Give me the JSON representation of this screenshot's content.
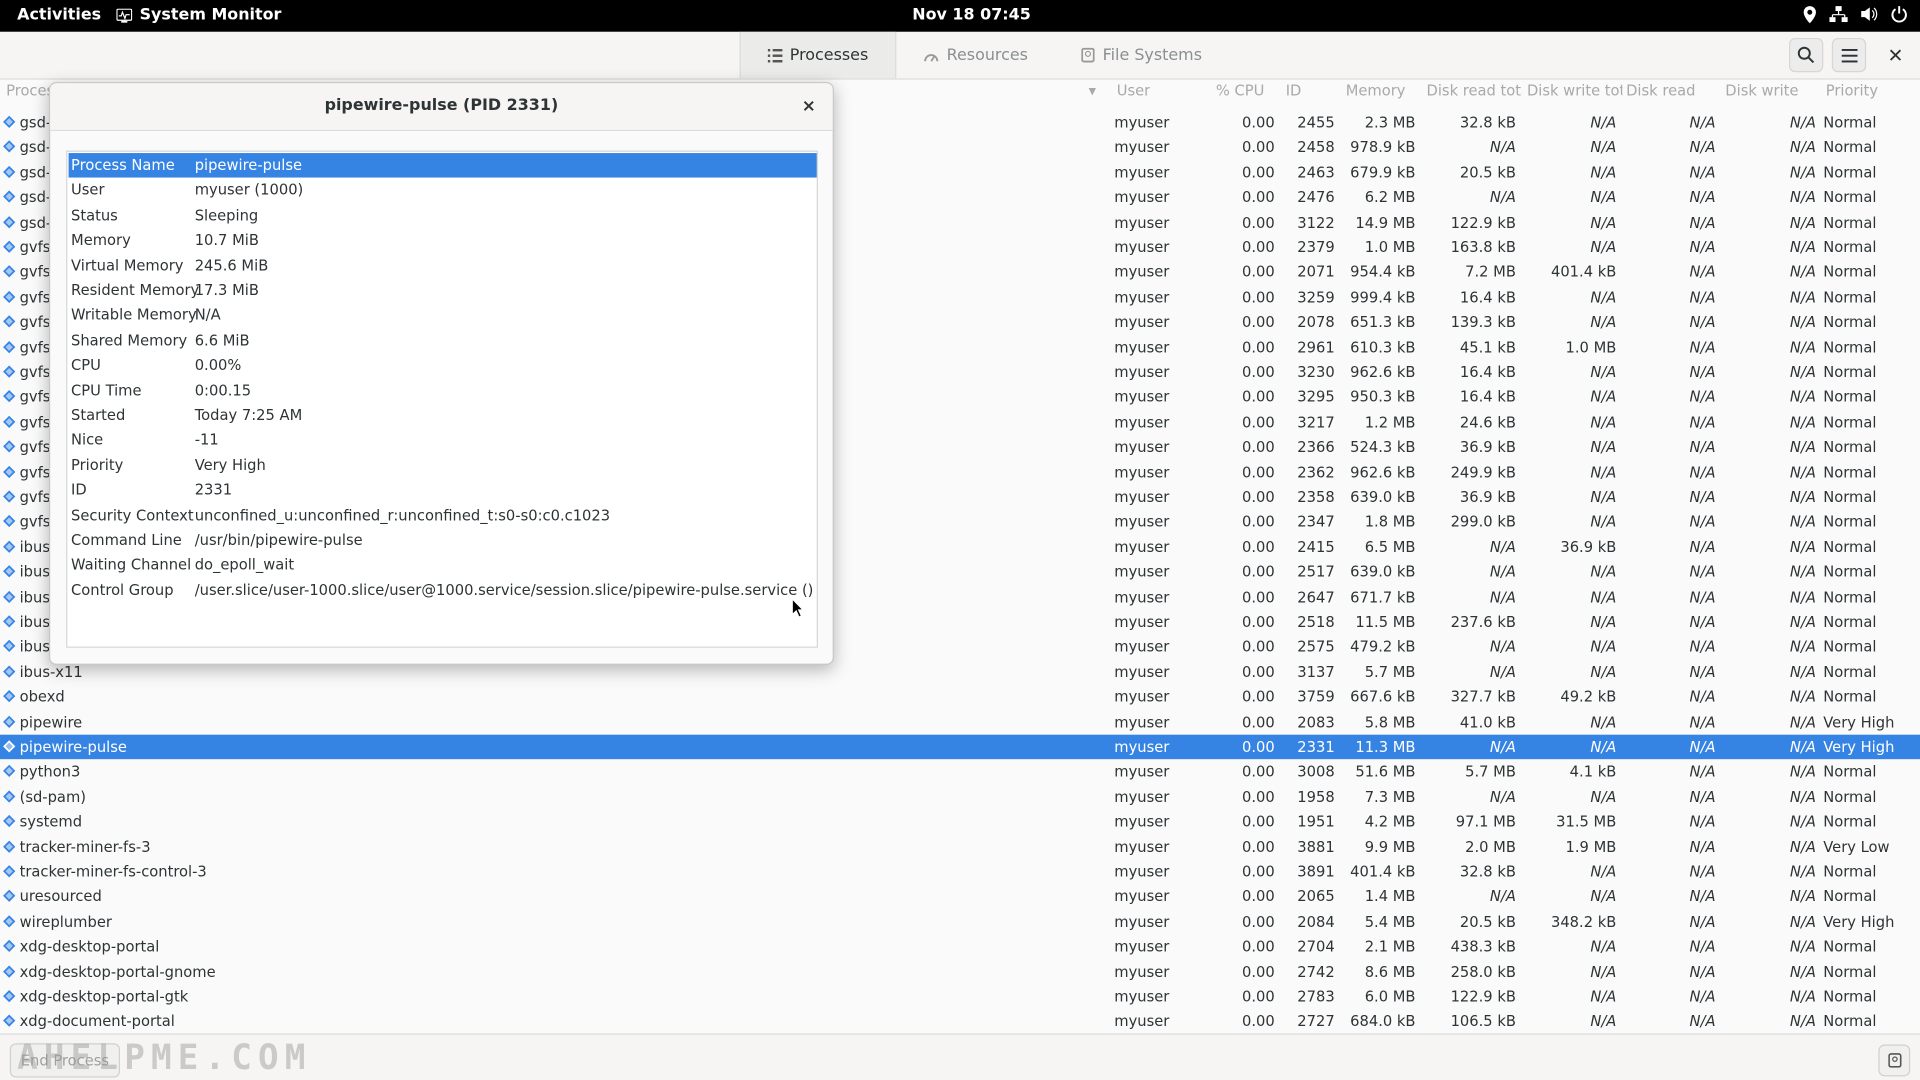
{
  "topbar": {
    "activities": "Activities",
    "app_name": "System Monitor",
    "clock": "Nov 18  07:45"
  },
  "header": {
    "tabs": [
      {
        "label": "Processes",
        "icon": "list-icon"
      },
      {
        "label": "Resources",
        "icon": "gauge-icon"
      },
      {
        "label": "File Systems",
        "icon": "disk-icon"
      }
    ]
  },
  "columns": {
    "process": "Proces",
    "user": "User",
    "cpu": "% CPU",
    "id": "ID",
    "memory": "Memory",
    "disk_read_total": "Disk read tota",
    "disk_write_total": "Disk write tot",
    "disk_read": "Disk read",
    "disk_write": "Disk write",
    "priority": "Priority"
  },
  "rows": [
    {
      "name": "gsd-",
      "user": "myuser",
      "cpu": "0.00",
      "id": "2455",
      "mem": "2.3 MB",
      "rtot": "32.8 kB",
      "wtot": "N/A",
      "rd": "N/A",
      "wr": "N/A",
      "prio": "Normal"
    },
    {
      "name": "gsd-",
      "user": "myuser",
      "cpu": "0.00",
      "id": "2458",
      "mem": "978.9 kB",
      "rtot": "N/A",
      "wtot": "N/A",
      "rd": "N/A",
      "wr": "N/A",
      "prio": "Normal"
    },
    {
      "name": "gsd-",
      "user": "myuser",
      "cpu": "0.00",
      "id": "2463",
      "mem": "679.9 kB",
      "rtot": "20.5 kB",
      "wtot": "N/A",
      "rd": "N/A",
      "wr": "N/A",
      "prio": "Normal"
    },
    {
      "name": "gsd-",
      "user": "myuser",
      "cpu": "0.00",
      "id": "2476",
      "mem": "6.2 MB",
      "rtot": "N/A",
      "wtot": "N/A",
      "rd": "N/A",
      "wr": "N/A",
      "prio": "Normal"
    },
    {
      "name": "gsd-",
      "user": "myuser",
      "cpu": "0.00",
      "id": "3122",
      "mem": "14.9 MB",
      "rtot": "122.9 kB",
      "wtot": "N/A",
      "rd": "N/A",
      "wr": "N/A",
      "prio": "Normal"
    },
    {
      "name": "gvfs-",
      "user": "myuser",
      "cpu": "0.00",
      "id": "2379",
      "mem": "1.0 MB",
      "rtot": "163.8 kB",
      "wtot": "N/A",
      "rd": "N/A",
      "wr": "N/A",
      "prio": "Normal"
    },
    {
      "name": "gvfsd",
      "user": "myuser",
      "cpu": "0.00",
      "id": "2071",
      "mem": "954.4 kB",
      "rtot": "7.2 MB",
      "wtot": "401.4 kB",
      "rd": "N/A",
      "wr": "N/A",
      "prio": "Normal"
    },
    {
      "name": "gvfsd",
      "user": "myuser",
      "cpu": "0.00",
      "id": "3259",
      "mem": "999.4 kB",
      "rtot": "16.4 kB",
      "wtot": "N/A",
      "rd": "N/A",
      "wr": "N/A",
      "prio": "Normal"
    },
    {
      "name": "gvfsd",
      "user": "myuser",
      "cpu": "0.00",
      "id": "2078",
      "mem": "651.3 kB",
      "rtot": "139.3 kB",
      "wtot": "N/A",
      "rd": "N/A",
      "wr": "N/A",
      "prio": "Normal"
    },
    {
      "name": "gvfsd",
      "user": "myuser",
      "cpu": "0.00",
      "id": "2961",
      "mem": "610.3 kB",
      "rtot": "45.1 kB",
      "wtot": "1.0 MB",
      "rd": "N/A",
      "wr": "N/A",
      "prio": "Normal"
    },
    {
      "name": "gvfsd",
      "user": "myuser",
      "cpu": "0.00",
      "id": "3230",
      "mem": "962.6 kB",
      "rtot": "16.4 kB",
      "wtot": "N/A",
      "rd": "N/A",
      "wr": "N/A",
      "prio": "Normal"
    },
    {
      "name": "gvfsd",
      "user": "myuser",
      "cpu": "0.00",
      "id": "3295",
      "mem": "950.3 kB",
      "rtot": "16.4 kB",
      "wtot": "N/A",
      "rd": "N/A",
      "wr": "N/A",
      "prio": "Normal"
    },
    {
      "name": "gvfsd",
      "user": "myuser",
      "cpu": "0.00",
      "id": "3217",
      "mem": "1.2 MB",
      "rtot": "24.6 kB",
      "wtot": "N/A",
      "rd": "N/A",
      "wr": "N/A",
      "prio": "Normal"
    },
    {
      "name": "gvfs-",
      "user": "myuser",
      "cpu": "0.00",
      "id": "2366",
      "mem": "524.3 kB",
      "rtot": "36.9 kB",
      "wtot": "N/A",
      "rd": "N/A",
      "wr": "N/A",
      "prio": "Normal"
    },
    {
      "name": "gvfs-",
      "user": "myuser",
      "cpu": "0.00",
      "id": "2362",
      "mem": "962.6 kB",
      "rtot": "249.9 kB",
      "wtot": "N/A",
      "rd": "N/A",
      "wr": "N/A",
      "prio": "Normal"
    },
    {
      "name": "gvfs-",
      "user": "myuser",
      "cpu": "0.00",
      "id": "2358",
      "mem": "639.0 kB",
      "rtot": "36.9 kB",
      "wtot": "N/A",
      "rd": "N/A",
      "wr": "N/A",
      "prio": "Normal"
    },
    {
      "name": "gvfs-",
      "user": "myuser",
      "cpu": "0.00",
      "id": "2347",
      "mem": "1.8 MB",
      "rtot": "299.0 kB",
      "wtot": "N/A",
      "rd": "N/A",
      "wr": "N/A",
      "prio": "Normal"
    },
    {
      "name": "ibus-",
      "user": "myuser",
      "cpu": "0.00",
      "id": "2415",
      "mem": "6.5 MB",
      "rtot": "N/A",
      "wtot": "36.9 kB",
      "rd": "N/A",
      "wr": "N/A",
      "prio": "Normal"
    },
    {
      "name": "ibus-",
      "user": "myuser",
      "cpu": "0.00",
      "id": "2517",
      "mem": "639.0 kB",
      "rtot": "N/A",
      "wtot": "N/A",
      "rd": "N/A",
      "wr": "N/A",
      "prio": "Normal"
    },
    {
      "name": "ibus-",
      "user": "myuser",
      "cpu": "0.00",
      "id": "2647",
      "mem": "671.7 kB",
      "rtot": "N/A",
      "wtot": "N/A",
      "rd": "N/A",
      "wr": "N/A",
      "prio": "Normal"
    },
    {
      "name": "ibus-",
      "user": "myuser",
      "cpu": "0.00",
      "id": "2518",
      "mem": "11.5 MB",
      "rtot": "237.6 kB",
      "wtot": "N/A",
      "rd": "N/A",
      "wr": "N/A",
      "prio": "Normal"
    },
    {
      "name": "ibus-",
      "user": "myuser",
      "cpu": "0.00",
      "id": "2575",
      "mem": "479.2 kB",
      "rtot": "N/A",
      "wtot": "N/A",
      "rd": "N/A",
      "wr": "N/A",
      "prio": "Normal"
    },
    {
      "name": "ibus-x11",
      "user": "myuser",
      "cpu": "0.00",
      "id": "3137",
      "mem": "5.7 MB",
      "rtot": "N/A",
      "wtot": "N/A",
      "rd": "N/A",
      "wr": "N/A",
      "prio": "Normal"
    },
    {
      "name": "obexd",
      "user": "myuser",
      "cpu": "0.00",
      "id": "3759",
      "mem": "667.6 kB",
      "rtot": "327.7 kB",
      "wtot": "49.2 kB",
      "rd": "N/A",
      "wr": "N/A",
      "prio": "Normal"
    },
    {
      "name": "pipewire",
      "user": "myuser",
      "cpu": "0.00",
      "id": "2083",
      "mem": "5.8 MB",
      "rtot": "41.0 kB",
      "wtot": "N/A",
      "rd": "N/A",
      "wr": "N/A",
      "prio": "Very High"
    },
    {
      "name": "pipewire-pulse",
      "user": "myuser",
      "cpu": "0.00",
      "id": "2331",
      "mem": "11.3 MB",
      "rtot": "N/A",
      "wtot": "N/A",
      "rd": "N/A",
      "wr": "N/A",
      "prio": "Very High",
      "selected": true
    },
    {
      "name": "python3",
      "user": "myuser",
      "cpu": "0.00",
      "id": "3008",
      "mem": "51.6 MB",
      "rtot": "5.7 MB",
      "wtot": "4.1 kB",
      "rd": "N/A",
      "wr": "N/A",
      "prio": "Normal"
    },
    {
      "name": "(sd-pam)",
      "user": "myuser",
      "cpu": "0.00",
      "id": "1958",
      "mem": "7.3 MB",
      "rtot": "N/A",
      "wtot": "N/A",
      "rd": "N/A",
      "wr": "N/A",
      "prio": "Normal"
    },
    {
      "name": "systemd",
      "user": "myuser",
      "cpu": "0.00",
      "id": "1951",
      "mem": "4.2 MB",
      "rtot": "97.1 MB",
      "wtot": "31.5 MB",
      "rd": "N/A",
      "wr": "N/A",
      "prio": "Normal"
    },
    {
      "name": "tracker-miner-fs-3",
      "user": "myuser",
      "cpu": "0.00",
      "id": "3881",
      "mem": "9.9 MB",
      "rtot": "2.0 MB",
      "wtot": "1.9 MB",
      "rd": "N/A",
      "wr": "N/A",
      "prio": "Very Low"
    },
    {
      "name": "tracker-miner-fs-control-3",
      "user": "myuser",
      "cpu": "0.00",
      "id": "3891",
      "mem": "401.4 kB",
      "rtot": "32.8 kB",
      "wtot": "N/A",
      "rd": "N/A",
      "wr": "N/A",
      "prio": "Normal"
    },
    {
      "name": "uresourced",
      "user": "myuser",
      "cpu": "0.00",
      "id": "2065",
      "mem": "1.4 MB",
      "rtot": "N/A",
      "wtot": "N/A",
      "rd": "N/A",
      "wr": "N/A",
      "prio": "Normal"
    },
    {
      "name": "wireplumber",
      "user": "myuser",
      "cpu": "0.00",
      "id": "2084",
      "mem": "5.4 MB",
      "rtot": "20.5 kB",
      "wtot": "348.2 kB",
      "rd": "N/A",
      "wr": "N/A",
      "prio": "Very High"
    },
    {
      "name": "xdg-desktop-portal",
      "user": "myuser",
      "cpu": "0.00",
      "id": "2704",
      "mem": "2.1 MB",
      "rtot": "438.3 kB",
      "wtot": "N/A",
      "rd": "N/A",
      "wr": "N/A",
      "prio": "Normal"
    },
    {
      "name": "xdg-desktop-portal-gnome",
      "user": "myuser",
      "cpu": "0.00",
      "id": "2742",
      "mem": "8.6 MB",
      "rtot": "258.0 kB",
      "wtot": "N/A",
      "rd": "N/A",
      "wr": "N/A",
      "prio": "Normal"
    },
    {
      "name": "xdg-desktop-portal-gtk",
      "user": "myuser",
      "cpu": "0.00",
      "id": "2783",
      "mem": "6.0 MB",
      "rtot": "122.9 kB",
      "wtot": "N/A",
      "rd": "N/A",
      "wr": "N/A",
      "prio": "Normal"
    },
    {
      "name": "xdg-document-portal",
      "user": "myuser",
      "cpu": "0.00",
      "id": "2727",
      "mem": "684.0 kB",
      "rtot": "106.5 kB",
      "wtot": "N/A",
      "rd": "N/A",
      "wr": "N/A",
      "prio": "Normal"
    }
  ],
  "bottom": {
    "end_process": "End Process",
    "watermark": "AHELPME.COM"
  },
  "dialog": {
    "title": "pipewire-pulse (PID 2331)",
    "props": [
      {
        "k": "Process Name",
        "v": "pipewire-pulse",
        "selected": true
      },
      {
        "k": "User",
        "v": "myuser (1000)"
      },
      {
        "k": "Status",
        "v": "Sleeping"
      },
      {
        "k": "Memory",
        "v": "10.7 MiB"
      },
      {
        "k": "Virtual Memory",
        "v": "245.6 MiB"
      },
      {
        "k": "Resident Memory",
        "v": "17.3 MiB"
      },
      {
        "k": "Writable Memory",
        "v": "N/A"
      },
      {
        "k": "Shared Memory",
        "v": "6.6 MiB"
      },
      {
        "k": "CPU",
        "v": "0.00%"
      },
      {
        "k": "CPU Time",
        "v": "0:00.15"
      },
      {
        "k": "Started",
        "v": "Today  7:25 AM"
      },
      {
        "k": "Nice",
        "v": "-11"
      },
      {
        "k": "Priority",
        "v": "Very High"
      },
      {
        "k": "ID",
        "v": "2331"
      },
      {
        "k": "Security Context",
        "v": "unconfined_u:unconfined_r:unconfined_t:s0-s0:c0.c1023"
      },
      {
        "k": "Command Line",
        "v": "/usr/bin/pipewire-pulse"
      },
      {
        "k": "Waiting Channel",
        "v": "do_epoll_wait"
      },
      {
        "k": "Control Group",
        "v": "/user.slice/user-1000.slice/user@1000.service/session.slice/pipewire-pulse.service ()"
      }
    ]
  },
  "colors": {
    "accent": "#3584e4",
    "topbar": "#000000",
    "headerbar": "#f6f5f4"
  }
}
